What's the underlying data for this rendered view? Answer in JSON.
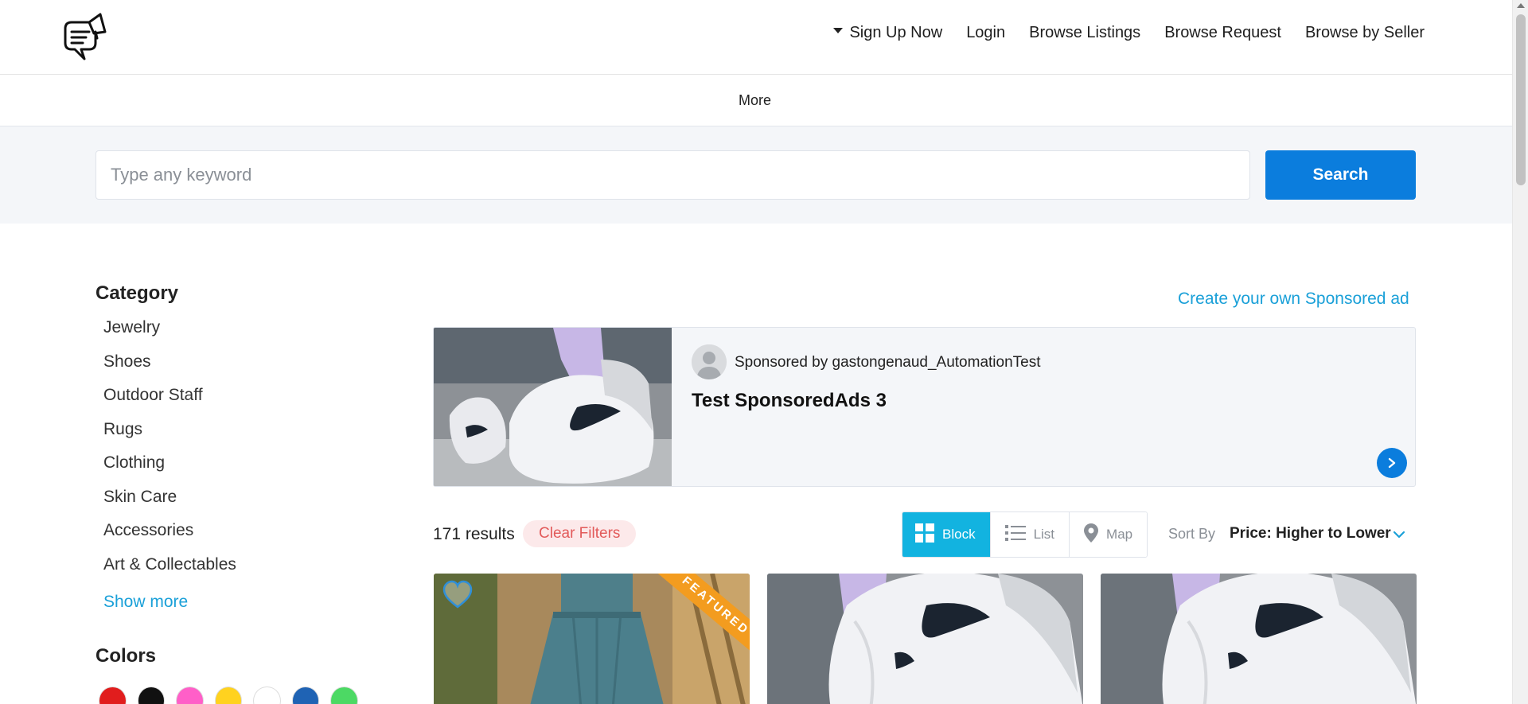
{
  "header": {
    "nav": [
      {
        "label": "Sign Up Now",
        "has_caret": true
      },
      {
        "label": "Login"
      },
      {
        "label": "Browse Listings"
      },
      {
        "label": "Browse Request"
      },
      {
        "label": "Browse by Seller"
      }
    ],
    "more_label": "More"
  },
  "search": {
    "placeholder": "Type any keyword",
    "value": "",
    "button_label": "Search"
  },
  "sidebar": {
    "category_heading": "Category",
    "categories": [
      "Jewelry",
      "Shoes",
      "Outdoor Staff",
      "Rugs",
      "Clothing",
      "Skin Care",
      "Accessories",
      "Art & Collectables"
    ],
    "show_more": "Show more",
    "colors_heading": "Colors",
    "colors": [
      "#e11d1d",
      "#111111",
      "#ff5fc8",
      "#ffd21f",
      "#ffffff",
      "#1f63b4",
      "#4cd964"
    ]
  },
  "sponsored": {
    "create_link": "Create your own Sponsored ad",
    "by_text": "Sponsored by gastongenaud_AutomationTest",
    "title": "Test SponsoredAds 3"
  },
  "results": {
    "count_text": "171 results",
    "clear_filters": "Clear Filters",
    "views": [
      {
        "label": "Block",
        "icon": "grid-icon",
        "active": true
      },
      {
        "label": "List",
        "icon": "list-icon",
        "active": false
      },
      {
        "label": "Map",
        "icon": "map-pin-icon",
        "active": false
      }
    ],
    "sort_label": "Sort By",
    "sort_value": "Price: Higher to Lower"
  },
  "listings": [
    {
      "image": "teal-dress",
      "featured": true,
      "featured_label": "FEATURED",
      "favorite_icon": "heart-icon"
    },
    {
      "image": "white-sneakers",
      "featured": false
    },
    {
      "image": "white-sneakers",
      "featured": false
    }
  ],
  "colors": {
    "primary": "#0b7ddd",
    "accent": "#12b3e0",
    "link": "#1aa0d8",
    "featured": "#f39c1f"
  }
}
